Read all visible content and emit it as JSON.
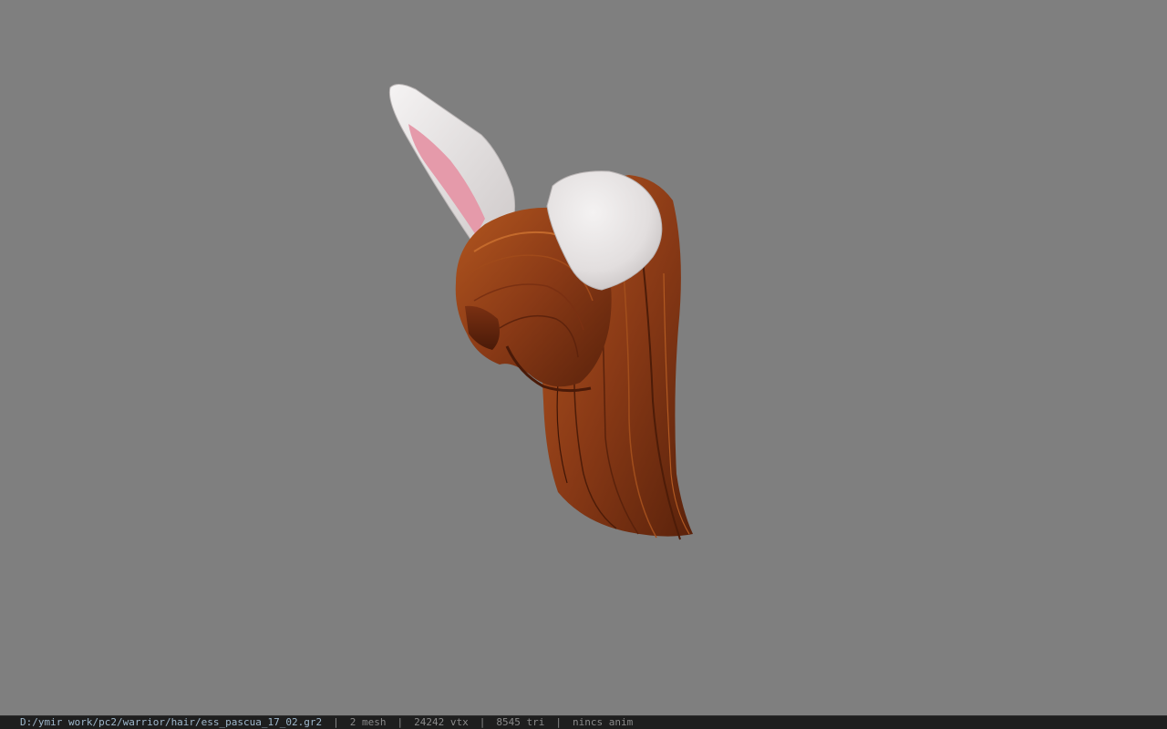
{
  "viewer": {
    "background_color": "#7f7f7f",
    "model": {
      "hair_color": "#8a3a16",
      "ear_color": "#e9e6e6",
      "ear_inner_color": "#e59aaa"
    }
  },
  "status_bar": {
    "file_path": "D:/ymir work/pc2/warrior/hair/ess_pascua_17_02.gr2",
    "mesh_count": "2 mesh",
    "vertex_count": "24242 vtx",
    "triangle_count": "8545 tri",
    "anim_status": "nincs anim",
    "separator": "|"
  }
}
